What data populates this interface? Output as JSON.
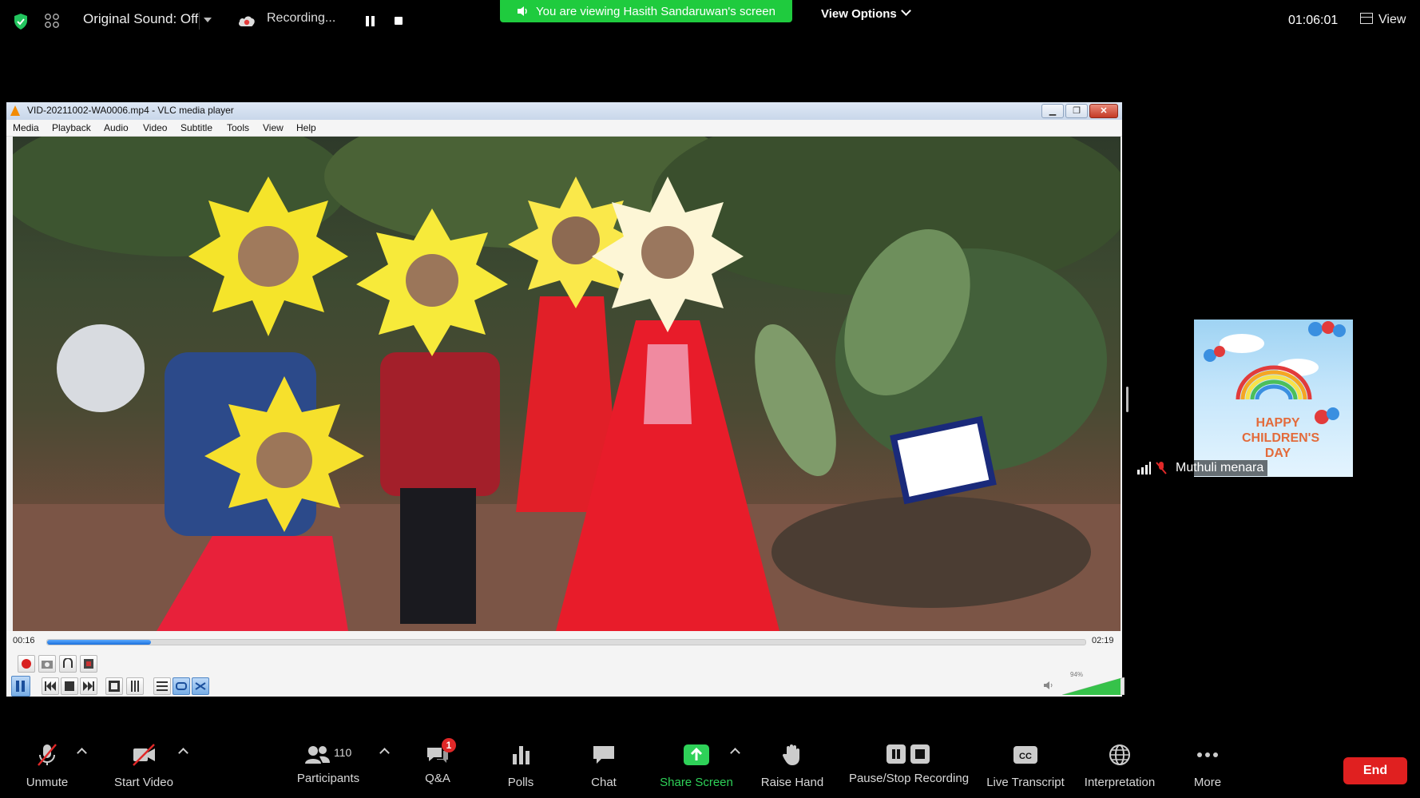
{
  "topbar": {
    "original_sound": "Original Sound: Off",
    "recording": "Recording...",
    "viewing_banner": "You are viewing Hasith Sandaruwan's screen",
    "view_options": "View Options",
    "timer": "01:06:01",
    "view": "View"
  },
  "vlc": {
    "title": "VID-20211002-WA0006.mp4 - VLC media player",
    "menu": [
      "Media",
      "Playback",
      "Audio",
      "Video",
      "Subtitle",
      "Tools",
      "View",
      "Help"
    ],
    "current_time": "00:16",
    "total_time": "02:19",
    "progress": 0.1,
    "volume_percent": "94%",
    "volume": 0.94
  },
  "participant": {
    "name": "Muthuli  menara",
    "tile_text": "HAPPY CHILDREN'S DAY"
  },
  "toolbar": {
    "unmute": "Unmute",
    "start_video": "Start Video",
    "participants": "Participants",
    "participants_count": "110",
    "qa": "Q&A",
    "qa_badge": "1",
    "polls": "Polls",
    "chat": "Chat",
    "share_screen": "Share Screen",
    "raise_hand": "Raise Hand",
    "pause_stop_recording": "Pause/Stop Recording",
    "live_transcript": "Live Transcript",
    "interpretation": "Interpretation",
    "more": "More",
    "end": "End"
  },
  "colors": {
    "banner_green": "#1fcb3e",
    "share_green": "#2ed158",
    "end_red": "#e02020",
    "badge_red": "#e02828",
    "vlc_progress_blue": "#1a6fdc"
  }
}
